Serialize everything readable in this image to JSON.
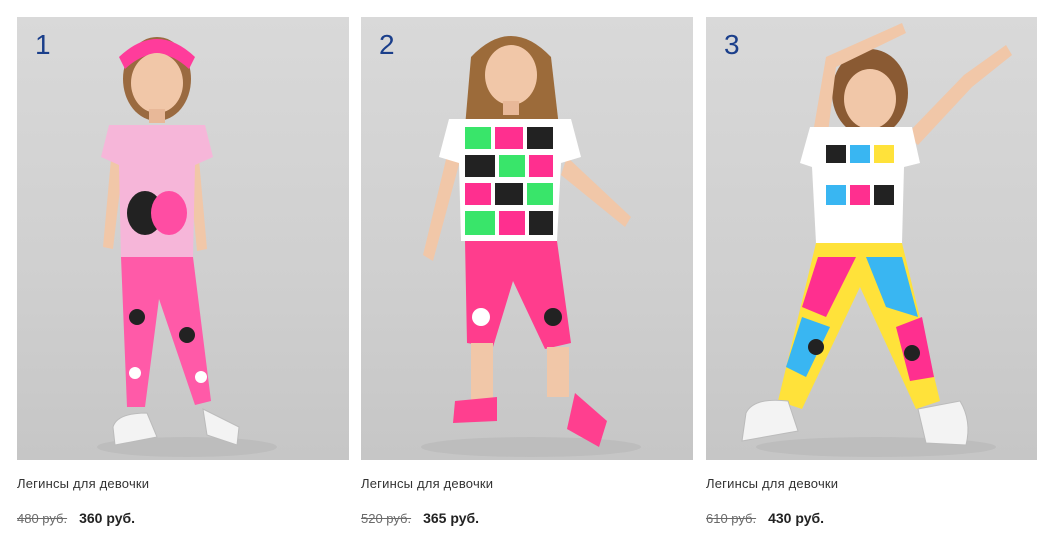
{
  "products": [
    {
      "number": "1",
      "title": "Легинсы для девочки",
      "old_price": "480 руб.",
      "price": "360 руб."
    },
    {
      "number": "2",
      "title": "Легинсы для девочки",
      "old_price": "520 руб.",
      "price": "365 руб."
    },
    {
      "number": "3",
      "title": "Легинсы для девочки",
      "old_price": "610 руб.",
      "price": "430 руб."
    }
  ],
  "colors": {
    "number": "#1b3f8b",
    "photo_background": "#d4d4d4",
    "skin": "#f1c7a8",
    "hair": "#8a5a33",
    "pink": "#ff2f8f",
    "light_pink": "#f6b6d9",
    "green": "#39e56a",
    "yellow": "#ffe23a",
    "blue": "#39b6f2"
  }
}
